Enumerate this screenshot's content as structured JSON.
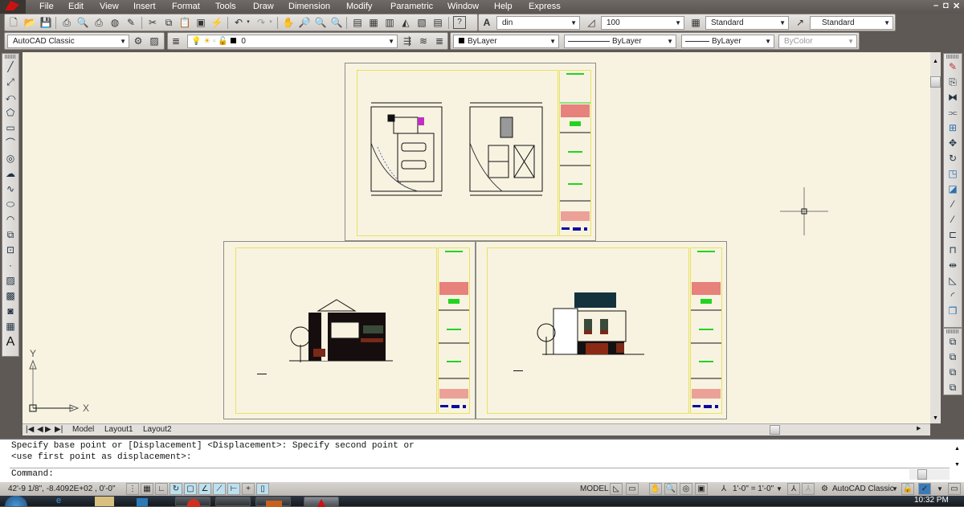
{
  "menubar": {
    "items": [
      "File",
      "Edit",
      "View",
      "Insert",
      "Format",
      "Tools",
      "Draw",
      "Dimension",
      "Modify",
      "Parametric",
      "Window",
      "Help",
      "Express"
    ],
    "window_controls": [
      "minimize",
      "restore",
      "close"
    ]
  },
  "toolbar_standard": {
    "icons": [
      "new-icon",
      "open-icon",
      "save-icon",
      "plot-icon",
      "plot-preview-icon",
      "publish-icon",
      "3d-print-icon",
      "design-center-icon",
      "cut-icon",
      "copy-icon",
      "paste-icon",
      "match-properties-icon",
      "block-editor-icon",
      "undo-icon",
      "redo-icon",
      "pan-icon",
      "zoom-realtime-icon",
      "zoom-window-icon",
      "zoom-previous-icon",
      "properties-icon",
      "design-center-palette-icon",
      "tool-palettes-icon",
      "sheet-set-icon",
      "markup-icon",
      "calculator-icon",
      "help-icon"
    ]
  },
  "toolbar_styles": {
    "text_style": "din",
    "dim_scale": "100",
    "table_style": "Standard",
    "multileader_style": "Standard"
  },
  "toolbar_workspace": {
    "workspace": "AutoCAD Classic"
  },
  "toolbar_layers": {
    "current_layer": "0"
  },
  "toolbar_properties": {
    "color": "ByLayer",
    "linetype": "ByLayer",
    "lineweight": "ByLayer",
    "plotstyle": "ByColor"
  },
  "draw_toolbar": [
    "line-icon",
    "construction-line-icon",
    "polyline-icon",
    "polygon-icon",
    "rectangle-icon",
    "arc-icon",
    "circle-icon",
    "revision-cloud-icon",
    "spline-icon",
    "ellipse-icon",
    "ellipse-arc-icon",
    "insert-block-icon",
    "make-block-icon",
    "point-icon",
    "hatch-icon",
    "gradient-icon",
    "region-icon",
    "table-icon",
    "multiline-text-icon"
  ],
  "modify_toolbar": [
    "erase-icon",
    "copy-object-icon",
    "mirror-icon",
    "offset-icon",
    "array-icon",
    "move-icon",
    "rotate-icon",
    "scale-icon",
    "stretch-icon",
    "trim-icon",
    "extend-icon",
    "break-at-point-icon",
    "break-icon",
    "join-icon",
    "chamfer-icon",
    "fillet-icon",
    "explode-icon"
  ],
  "draworder_toolbar": [
    "bring-to-front-icon",
    "send-to-back-icon",
    "bring-above-icon",
    "send-under-icon"
  ],
  "canvas": {
    "ucs": {
      "x_label": "X",
      "y_label": "Y"
    },
    "sheets": [
      {
        "name": "floor-plans-sheet",
        "content": "Ground and upper floor plans"
      },
      {
        "name": "front-elevation-sheet",
        "content": "Front elevation"
      },
      {
        "name": "side-elevation-sheet",
        "content": "Side elevation"
      }
    ],
    "colors": {
      "background": "#f8f3e1",
      "frame": "#e7e25c",
      "accent_green": "#22d322",
      "accent_red": "#e05050",
      "accent_blue": "#0a0aa0"
    }
  },
  "layout_tabs": [
    "Model",
    "Layout1",
    "Layout2"
  ],
  "command": {
    "history": [
      "Specify base point or [Displacement] <Displacement>: Specify second point or",
      "<use first point as displacement>:"
    ],
    "prompt": "Command:"
  },
  "status": {
    "coordinates": "42'-9 1/8\",  -8.4092E+02 , 0'-0\"",
    "toggles": [
      {
        "name": "infer-constraints",
        "on": false
      },
      {
        "name": "grid",
        "on": false
      },
      {
        "name": "ortho",
        "on": false
      },
      {
        "name": "polar",
        "on": true
      },
      {
        "name": "osnap",
        "on": true
      },
      {
        "name": "3d-osnap",
        "on": true
      },
      {
        "name": "otrack",
        "on": true
      },
      {
        "name": "ducs",
        "on": true
      },
      {
        "name": "dyn",
        "on": false
      },
      {
        "name": "lweight",
        "on": true
      }
    ],
    "space": "MODEL",
    "annotation_scale": "1'-0\" = 1'-0\"",
    "workspace": "AutoCAD Classic"
  },
  "taskbar": {
    "time": "10:32 PM"
  }
}
